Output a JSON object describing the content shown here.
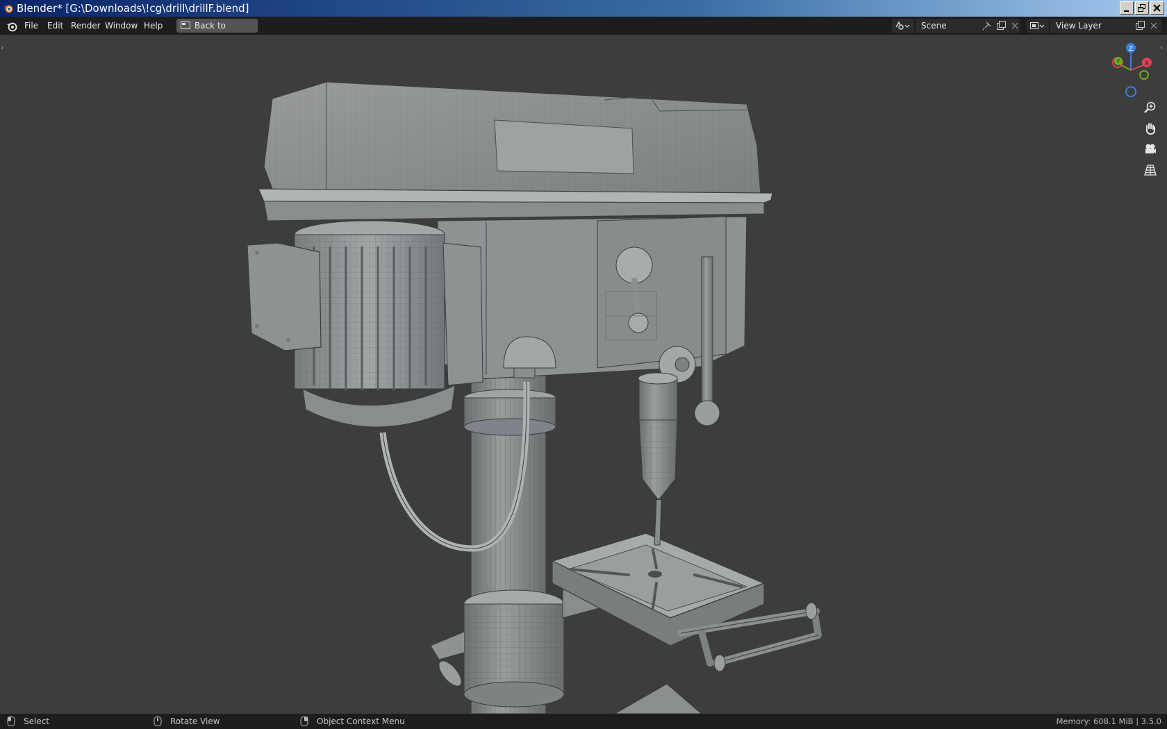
{
  "window": {
    "title": "Blender* [G:\\Downloads\\!cg\\drill\\drillF.blend]"
  },
  "menu": {
    "items": [
      "File",
      "Edit",
      "Render",
      "Window",
      "Help"
    ],
    "back_label": "Back to Previous"
  },
  "scene": {
    "name": "Scene",
    "view_layer": "View Layer"
  },
  "gizmo": {
    "x_label": "X",
    "y_label": "Y",
    "z_label": "Z",
    "x_color": "#e0414f",
    "y_color": "#6fab22",
    "z_color": "#3b7fe0"
  },
  "nav_icons": [
    "zoom-icon",
    "hand-pan-icon",
    "camera-icon",
    "grid-perspective-icon"
  ],
  "status": {
    "select": "Select",
    "rotate": "Rotate View",
    "context": "Object Context Menu",
    "memory": "Memory: 608.1 MiB | 3.5.0"
  }
}
